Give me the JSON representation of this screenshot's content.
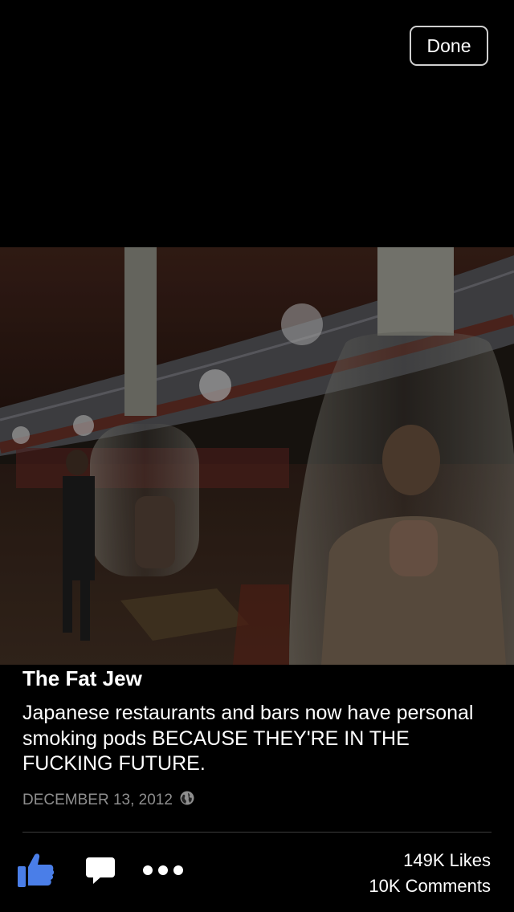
{
  "header": {
    "done_label": "Done"
  },
  "post": {
    "author": "The Fat Jew",
    "caption": "Japanese restaurants and bars now have personal smoking pods BECAUSE THEY'RE IN THE FUCKING FUTURE.",
    "date": "DECEMBER 13, 2012",
    "privacy_icon": "globe-icon",
    "photo_description": "restaurant interior with glass smoking pods"
  },
  "stats": {
    "likes": "149K Likes",
    "comments": "10K Comments"
  },
  "actions": {
    "like_icon": "thumbs-up-icon",
    "comment_icon": "speech-bubble-icon",
    "more_icon": "ellipsis-icon"
  },
  "colors": {
    "like_blue": "#4a7ee8",
    "date_gray": "#8e8e8e",
    "background": "#000000"
  }
}
